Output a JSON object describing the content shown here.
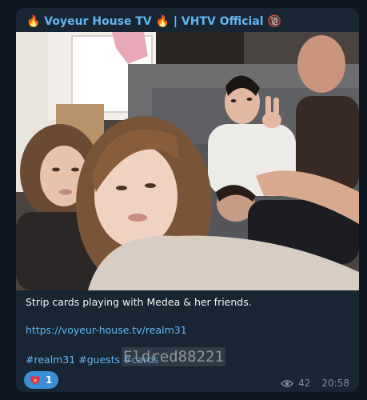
{
  "post": {
    "channel_title": "🔥 Voyeur House TV 🔥 | VHTV Official 🔞",
    "text": "Strip cards playing with Medea & her friends.",
    "link": "https://voyeur-house.tv/realm31",
    "hashtags": [
      "#realm31",
      "#guests",
      "#cards"
    ],
    "watermark": "Eldred88221",
    "reaction": {
      "emoji": "❤️‍🔥",
      "count": "1"
    },
    "views": "42",
    "time": "20:58"
  },
  "photo": {
    "subject": "group selfie of five people on a grey sofa",
    "accent_colors": [
      "#d8cdc2",
      "#6b4a33",
      "#2c2e33"
    ]
  },
  "colors": {
    "page_bg": "#0e1621",
    "bubble_bg": "#182533",
    "accent_blue": "#64b5ef",
    "reaction_bg": "#3a8fd6",
    "meta_text": "#7f8c99"
  }
}
